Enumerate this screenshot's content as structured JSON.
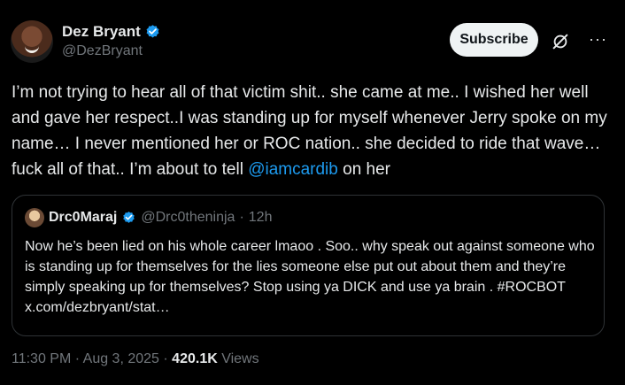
{
  "author": {
    "display_name": "Dez Bryant",
    "handle": "@DezBryant"
  },
  "subscribe_label": "Subscribe",
  "more_label": "···",
  "tweet": {
    "text_part1": "I’m not trying to hear all of that victim shit.. she came at me.. I wished her well and gave her respect..I was standing up for myself whenever Jerry spoke on my name… I never mentioned her or ROC nation.. she decided to ride that wave…  fuck all of that.. I’m about to tell ",
    "mention": "@iamcardib",
    "text_part2": " on her"
  },
  "quote": {
    "display_name": "Drc0Maraj",
    "handle": "@Drc0theninja",
    "separator": "·",
    "time": "12h",
    "text": "Now he’s been lied on his whole career lmaoo . Soo.. why speak out against someone who is standing up for themselves for the lies someone else put out about them and they’re simply speaking up for themselves? Stop using ya DICK and use ya brain . #ROCBOT x.com/dezbryant/stat…"
  },
  "meta": {
    "time": "11:30 PM",
    "separator1": "·",
    "date": "Aug 3, 2025",
    "separator2": "·",
    "views_count": "420.1K",
    "views_label": "Views"
  },
  "colors": {
    "background": "#000000",
    "text": "#e7e9ea",
    "muted": "#71767b",
    "link": "#1d9bf0",
    "verified": "#1d9bf0"
  },
  "icons": [
    "verified-badge-icon",
    "grok-icon",
    "more-options-icon"
  ]
}
